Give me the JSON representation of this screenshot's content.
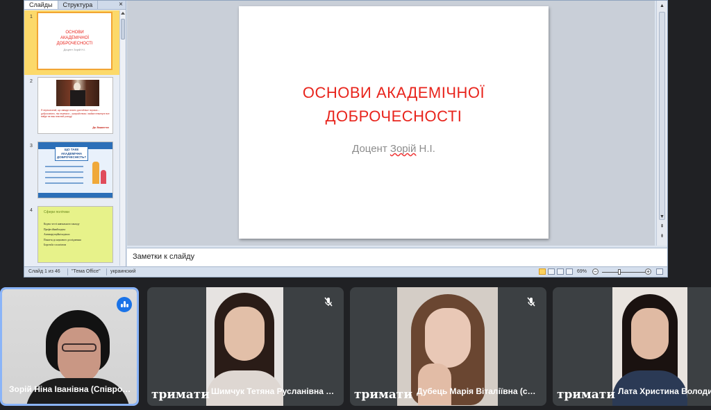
{
  "ppt": {
    "tabs": [
      "Слайды",
      "Структура"
    ],
    "close_glyph": "×",
    "thumbnails": [
      {
        "num": "1",
        "title": "ОСНОВИ АКАДЕМІЧНОЇ ДОБРОЧЕСНОСТІ",
        "subtitle": "Доцент Зорій Н.І."
      },
      {
        "num": "2",
        "quote": "Я переконаний, що завжди значно достойніше поразка – добросовісно, ніж перемога – шахрайством; і майже неминуче все вийде на ваш власний розсуд!",
        "author": "Дж. Вашингтон"
      },
      {
        "num": "3",
        "heading": "ЩО ТАКЕ АКАДЕМІЧНА ДОБРОЧЕСНІСТЬ?"
      },
      {
        "num": "4",
        "heading": "Сфери політики",
        "items": [
          "Кодекс честі навчального закладу",
          "Професійний кодекс",
          "Антикорупційні кодекси",
          "Поняття до наукового дослідження",
          "Боротьба з плагіатом"
        ]
      }
    ],
    "main_slide": {
      "title_line1": "ОСНОВИ АКАДЕМІЧНОЇ",
      "title_line2": "ДОБРОЧЕСНОСТІ",
      "subtitle_pre": "Доцент ",
      "subtitle_name": "Зорій",
      "subtitle_post": " Н.І."
    },
    "notes_placeholder": "Заметки к слайду",
    "status": {
      "slide": "Слайд 1 из 46",
      "theme": "\"Тема Office\"",
      "language": "украинский",
      "zoom": "69%",
      "zoom_fraction": 0.69
    },
    "colors": {
      "slide_title": "#e8241c",
      "selection": "#fcd96a"
    }
  },
  "participants": [
    {
      "name": "Зорій Ніна Іванівна (Співро…",
      "speaking": true,
      "muted": false,
      "hold_text": ""
    },
    {
      "name": "Шимчук Тетяна Русланівна …",
      "speaking": false,
      "muted": true,
      "hold_text": "тримати"
    },
    {
      "name": "Дубець Марія Віталіївна (с…",
      "speaking": false,
      "muted": true,
      "hold_text": "тримати"
    },
    {
      "name": "Лата Христина Володи",
      "speaking": false,
      "muted": false,
      "hold_text": "тримати"
    }
  ],
  "icons": {
    "mic_off": "mic-off-icon",
    "speaking": "speaking-indicator-icon"
  }
}
